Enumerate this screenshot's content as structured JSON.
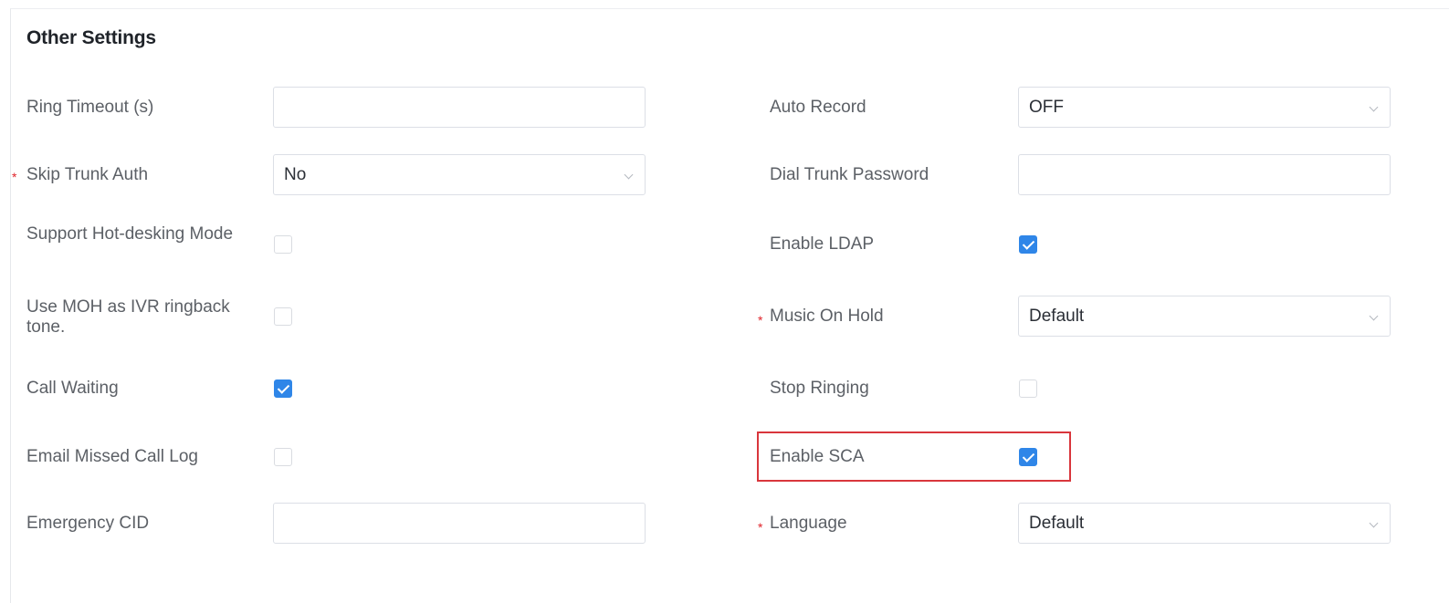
{
  "section": {
    "title": "Other Settings"
  },
  "left_fields": [
    {
      "label": "Ring Timeout (s)",
      "required": false,
      "control": "input",
      "value": ""
    },
    {
      "label": "Skip Trunk Auth",
      "required": true,
      "control": "select",
      "value": "No"
    },
    {
      "label": "Support Hot-desking Mode",
      "required": false,
      "control": "checkbox",
      "checked": false
    },
    {
      "label": "Use MOH as IVR ringback tone.",
      "required": false,
      "control": "checkbox",
      "checked": false
    },
    {
      "label": "Call Waiting",
      "required": false,
      "control": "checkbox",
      "checked": true
    },
    {
      "label": "Email Missed Call Log",
      "required": false,
      "control": "checkbox",
      "checked": false
    },
    {
      "label": "Emergency CID",
      "required": false,
      "control": "input",
      "value": ""
    }
  ],
  "right_fields": [
    {
      "label": "Auto Record",
      "required": false,
      "control": "select",
      "value": "OFF"
    },
    {
      "label": "Dial Trunk Password",
      "required": false,
      "control": "input",
      "value": ""
    },
    {
      "label": "Enable LDAP",
      "required": false,
      "control": "checkbox",
      "checked": true
    },
    {
      "label": "Music On Hold",
      "required": true,
      "control": "select",
      "value": "Default"
    },
    {
      "label": "Stop Ringing",
      "required": false,
      "control": "checkbox",
      "checked": false
    },
    {
      "label": "Enable SCA",
      "required": false,
      "control": "checkbox",
      "checked": true,
      "highlighted": true
    },
    {
      "label": "Language",
      "required": true,
      "control": "select",
      "value": "Default"
    }
  ],
  "required_marker": "*",
  "colors": {
    "accent": "#2f86e8",
    "required": "#e0242b",
    "highlight_border": "#d9363c"
  }
}
